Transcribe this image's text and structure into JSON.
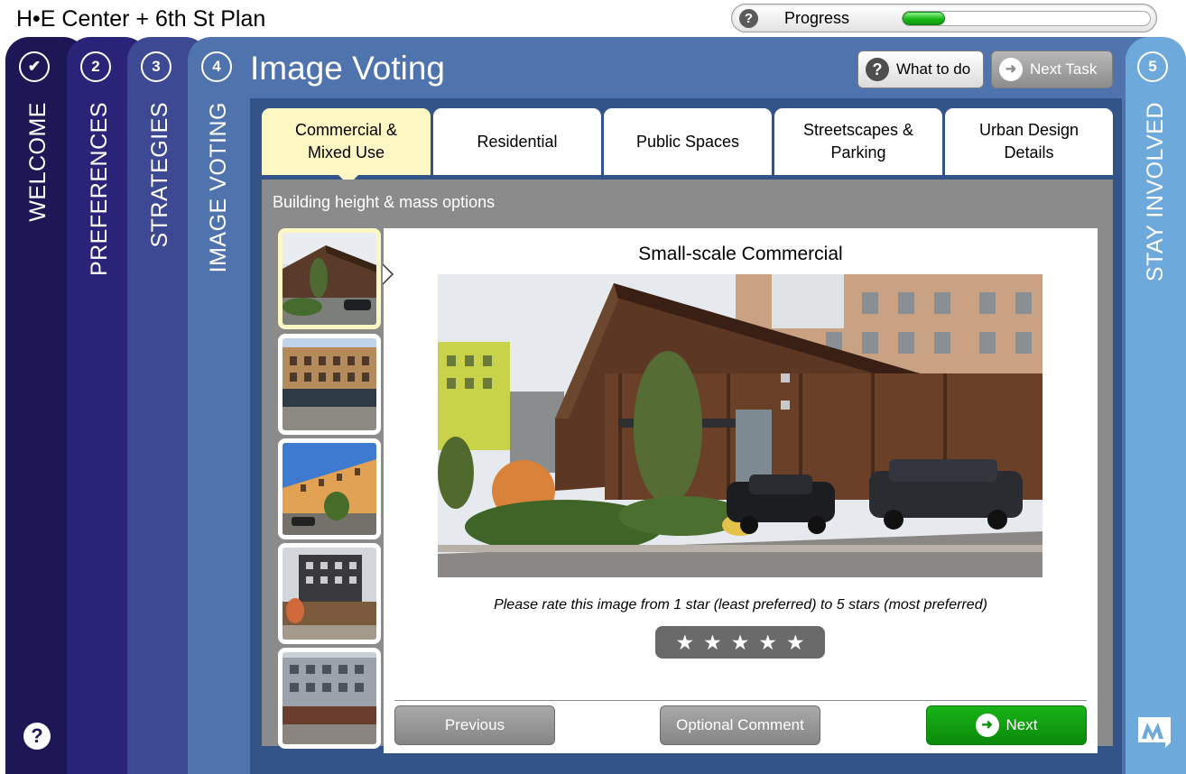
{
  "app": {
    "title": "H•E Center + 6th St Plan"
  },
  "progress": {
    "label": "Progress",
    "value": 0.17,
    "icon": "help-icon"
  },
  "steps": [
    {
      "marker": "✔",
      "label": "WELCOME",
      "color": "#1d1755",
      "state": "complete"
    },
    {
      "marker": "2",
      "label": "PREFERENCES",
      "color": "#2a2479"
    },
    {
      "marker": "3",
      "label": "STRATEGIES",
      "color": "#3d4a93"
    },
    {
      "marker": "4",
      "label": "IMAGE VOTING",
      "color": "#4f73ad",
      "state": "active"
    },
    {
      "marker": "5",
      "label": "STAY INVOLVED",
      "color": "#6ea9db"
    }
  ],
  "help_icon_glyph": "?",
  "main": {
    "title": "Image Voting",
    "what_to_do": "What to do",
    "next_task": "Next Task",
    "tabs": [
      {
        "label": "Commercial & Mixed Use",
        "active": true
      },
      {
        "label": "Residential"
      },
      {
        "label": "Public Spaces"
      },
      {
        "label": "Streetscapes & Parking"
      },
      {
        "label": "Urban Design Details"
      }
    ],
    "section_label": "Building height & mass options",
    "image_title": "Small-scale Commercial",
    "rating_prompt": "Please rate this image from 1 star (least preferred) to 5 stars (most preferred)",
    "rating": {
      "max": 5,
      "value": 0
    },
    "buttons": {
      "previous": "Previous",
      "comment": "Optional Comment",
      "next": "Next"
    }
  },
  "colors": {
    "accent_active_tab": "#fdf7c3",
    "next_green": "#129a12",
    "progress_green": "#19b619"
  }
}
